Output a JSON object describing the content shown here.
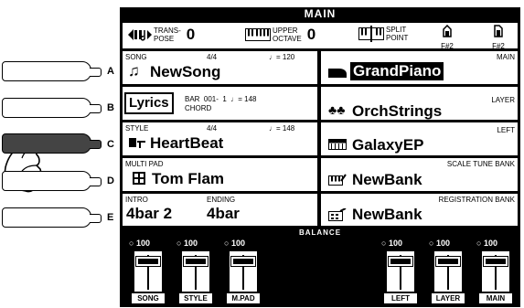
{
  "screen_title": "MAIN",
  "top_bar": {
    "transpose_label_1": "TRANS-",
    "transpose_label_2": "POSE",
    "transpose_value": "0",
    "upper_octave_label_1": "UPPER",
    "upper_octave_label_2": "OCTAVE",
    "upper_octave_value": "0",
    "split_point_label_1": "SPLIT",
    "split_point_label_2": "POINT",
    "split_note_1": "F#2",
    "split_note_2": "F#2"
  },
  "side_buttons": [
    "A",
    "B",
    "C",
    "D",
    "E"
  ],
  "left": {
    "song": {
      "label": "SONG",
      "time_sig": "4/4",
      "tempo": "♩= 120",
      "name": "NewSong"
    },
    "lyrics": {
      "button": "Lyrics",
      "bar": "BAR  001-  1  ♩= 148",
      "chord": "CHORD"
    },
    "style": {
      "label": "STYLE",
      "time_sig": "4/4",
      "tempo": "♩= 148",
      "name": "HeartBeat"
    },
    "multipad": {
      "label": "MULTI PAD",
      "name": "Tom Flam"
    },
    "intro_ending": {
      "intro_label": "INTRO",
      "ending_label": "ENDING",
      "intro_value": "4bar 2",
      "ending_value": "4bar"
    }
  },
  "right": {
    "main": {
      "label": "MAIN",
      "name": "GrandPiano"
    },
    "layer": {
      "label": "LAYER",
      "name": "OrchStrings"
    },
    "left": {
      "label": "LEFT",
      "name": "GalaxyEP"
    },
    "scale_tune": {
      "label": "SCALE TUNE BANK",
      "name": "NewBank"
    },
    "registration": {
      "label": "REGISTRATION BANK",
      "name": "NewBank"
    }
  },
  "balance": {
    "title": "BALANCE",
    "faders": [
      {
        "value": "100",
        "label": "SONG"
      },
      {
        "value": "100",
        "label": "STYLE"
      },
      {
        "value": "100",
        "label": "M.PAD"
      },
      {
        "value": "100",
        "label": "LEFT"
      },
      {
        "value": "100",
        "label": "LAYER"
      },
      {
        "value": "100",
        "label": "MAIN"
      }
    ]
  }
}
